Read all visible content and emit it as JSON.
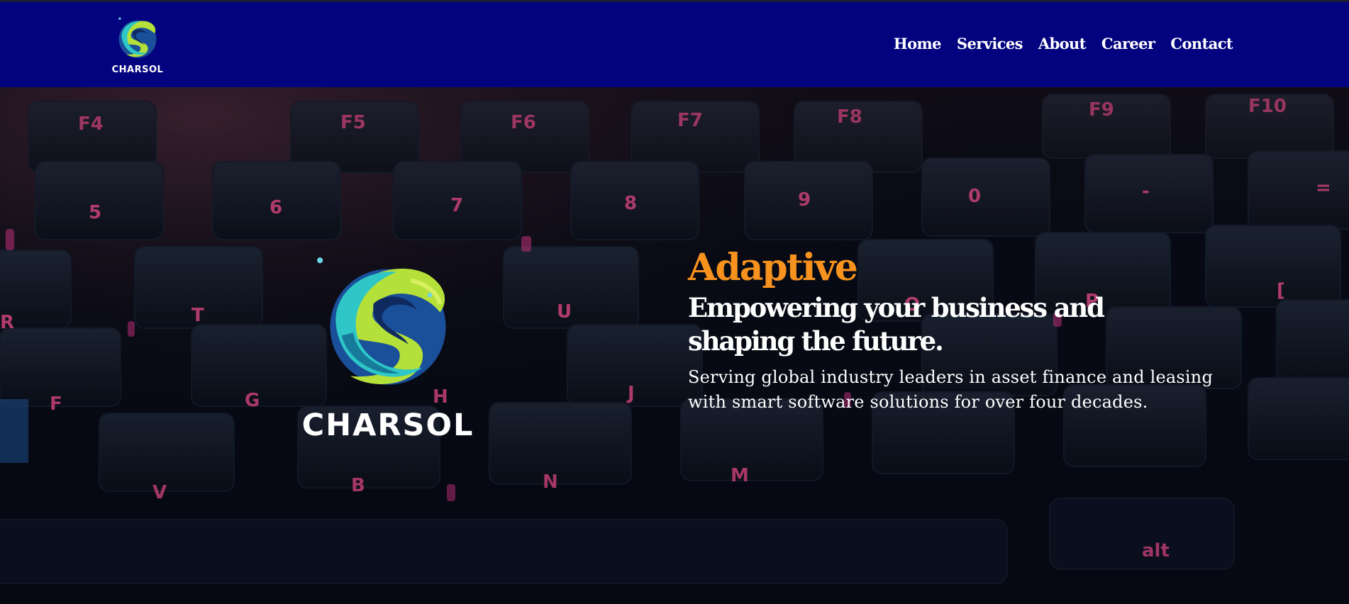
{
  "header": {
    "brand_name": "CHARSOL",
    "nav": [
      {
        "label": "Home"
      },
      {
        "label": "Services"
      },
      {
        "label": "About"
      },
      {
        "label": "Career"
      },
      {
        "label": "Contact"
      }
    ]
  },
  "hero": {
    "background": "keyboard-photo",
    "logo_icon": "swirl-s-logo-icon",
    "brand_name": "CHARSOL",
    "eyebrow": "Adaptive",
    "headline": "Empowering your business and shaping the future.",
    "description": "Serving global industry leaders in asset finance and leasing with smart software solutions for over four decades."
  },
  "colors": {
    "header_bg": "#03037f",
    "accent": "#f7921e",
    "text": "#ffffff",
    "logo_green": "#b5e03a",
    "logo_teal": "#2ec6c6",
    "logo_blue": "#1a6fb5"
  }
}
